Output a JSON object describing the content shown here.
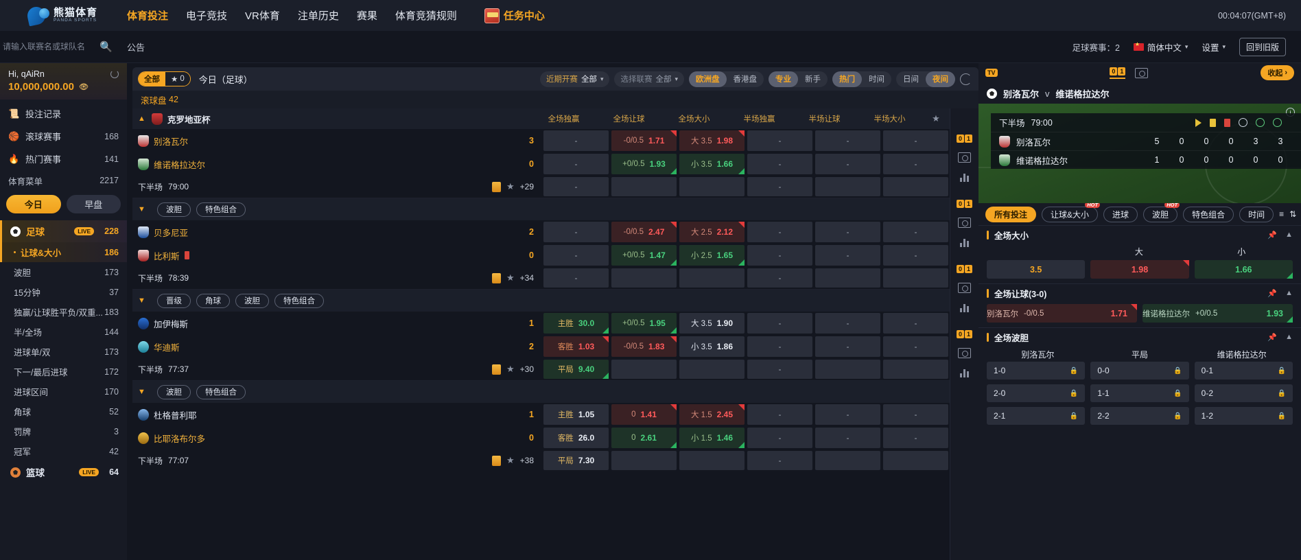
{
  "header": {
    "logo_cn": "熊猫体育",
    "logo_en": "PANDA SPORTS",
    "nav": [
      {
        "label": "体育投注",
        "active": true
      },
      {
        "label": "电子竞技",
        "active": false
      },
      {
        "label": "VR体育",
        "active": false
      },
      {
        "label": "注单历史",
        "active": false
      },
      {
        "label": "赛果",
        "active": false
      },
      {
        "label": "体育竞猜规则",
        "active": false
      }
    ],
    "mission": "任务中心",
    "clock": "00:04:07(GMT+8)"
  },
  "searchrow": {
    "placeholder": "请输入联赛名或球队名",
    "notice": "公告",
    "count": "足球赛事：2",
    "language": "简体中文",
    "settings": "设置",
    "old_version": "回到旧版"
  },
  "sidebar": {
    "greeting": "Hi, qAiRn",
    "balance": "10,000,000.00",
    "nav": [
      {
        "label": "投注记录",
        "count": "",
        "icon": "receipt-icon"
      },
      {
        "label": "滚球赛事",
        "count": "168",
        "icon": "live-ball-icon"
      },
      {
        "label": "热门赛事",
        "count": "141",
        "icon": "flame-icon"
      }
    ],
    "menu_title": "体育菜单",
    "menu_count": "2217",
    "day_tabs": [
      {
        "label": "今日",
        "active": true
      },
      {
        "label": "早盘",
        "active": false
      }
    ],
    "sport": {
      "label": "足球",
      "live": "LIVE",
      "count": "228"
    },
    "markets": [
      {
        "label": "让球&大小",
        "count": "186",
        "active": true
      },
      {
        "label": "波胆",
        "count": "173",
        "active": false
      },
      {
        "label": "15分钟",
        "count": "37",
        "active": false
      },
      {
        "label": "独赢/让球胜平负/双重...",
        "count": "183",
        "active": false
      },
      {
        "label": "半/全场",
        "count": "144",
        "active": false
      },
      {
        "label": "进球单/双",
        "count": "173",
        "active": false
      },
      {
        "label": "下一/最后进球",
        "count": "172",
        "active": false
      },
      {
        "label": "进球区间",
        "count": "170",
        "active": false
      },
      {
        "label": "角球",
        "count": "52",
        "active": false
      },
      {
        "label": "罚牌",
        "count": "3",
        "active": false
      },
      {
        "label": "冠军",
        "count": "42",
        "active": false
      }
    ],
    "sport2": {
      "label": "篮球",
      "live": "LIVE",
      "count": "64"
    }
  },
  "filterbar": {
    "seg_all": "全部",
    "seg_fav_count": "0",
    "today_label": "今日（足球）",
    "recent_key": "近期开赛",
    "recent_val": "全部",
    "league_key": "选择联赛",
    "league_val": "全部",
    "odds_types": [
      {
        "label": "欧洲盘",
        "active": true
      },
      {
        "label": "香港盘",
        "active": false
      }
    ],
    "modes": [
      {
        "label": "专业",
        "active": true
      },
      {
        "label": "新手",
        "active": false
      }
    ],
    "sorts": [
      {
        "label": "热门",
        "active": true
      },
      {
        "label": "时间",
        "active": false
      }
    ],
    "themes": [
      {
        "label": "日间",
        "active": false
      },
      {
        "label": "夜间",
        "active": true
      }
    ]
  },
  "rolling": {
    "label": "滚球盘",
    "count": "42"
  },
  "columns": [
    "全场独赢",
    "全场让球",
    "全场大小",
    "半场独赢",
    "半场让球",
    "半场大小"
  ],
  "matches": [
    {
      "league": "克罗地亚杯",
      "show_columns": true,
      "home": {
        "name": "别洛瓦尔",
        "score": "3"
      },
      "away": {
        "name": "维诺格拉达尔",
        "score": "0"
      },
      "phase": "下半场",
      "time": "79:00",
      "more": "+29",
      "home_cells": [
        {
          "type": "dash",
          "text": "-"
        },
        {
          "type": "red",
          "handicap": "-0/0.5",
          "odd": "1.71",
          "arrow": "up"
        },
        {
          "type": "red",
          "handicap": "大 3.5",
          "odd": "1.98",
          "arrow": "up"
        },
        {
          "type": "dash",
          "text": "-"
        },
        {
          "type": "dash",
          "text": "-"
        },
        {
          "type": "dash",
          "text": "-"
        }
      ],
      "away_cells": [
        {
          "type": "dash",
          "text": "-"
        },
        {
          "type": "green",
          "handicap": "+0/0.5",
          "odd": "1.93",
          "arrow": "dn"
        },
        {
          "type": "green",
          "handicap": "小 3.5",
          "odd": "1.66",
          "arrow": "dn"
        },
        {
          "type": "dash",
          "text": "-"
        },
        {
          "type": "dash",
          "text": "-"
        },
        {
          "type": "dash",
          "text": "-"
        }
      ],
      "draw_cells": [
        {
          "type": "dash",
          "text": "-"
        },
        {
          "type": "empty",
          "text": ""
        },
        {
          "type": "empty",
          "text": ""
        },
        {
          "type": "dash",
          "text": "-"
        },
        {
          "type": "empty",
          "text": ""
        },
        {
          "type": "empty",
          "text": ""
        }
      ],
      "tags": [
        "波胆",
        "特色组合"
      ]
    },
    {
      "league": "",
      "show_columns": false,
      "home": {
        "name": "贝多尼亚",
        "score": "2"
      },
      "away": {
        "name": "比利斯",
        "score": "0"
      },
      "phase": "下半场",
      "time": "78:39",
      "more": "+34",
      "home_cells": [
        {
          "type": "dash",
          "text": "-"
        },
        {
          "type": "red",
          "handicap": "-0/0.5",
          "odd": "2.47",
          "arrow": "up"
        },
        {
          "type": "red",
          "handicap": "大 2.5",
          "odd": "2.12",
          "arrow": "up"
        },
        {
          "type": "dash",
          "text": "-"
        },
        {
          "type": "dash",
          "text": "-"
        },
        {
          "type": "dash",
          "text": "-"
        }
      ],
      "away_cells": [
        {
          "type": "dash",
          "text": "-"
        },
        {
          "type": "green",
          "handicap": "+0/0.5",
          "odd": "1.47",
          "arrow": "dn"
        },
        {
          "type": "green",
          "handicap": "小 2.5",
          "odd": "1.65",
          "arrow": "dn"
        },
        {
          "type": "dash",
          "text": "-"
        },
        {
          "type": "dash",
          "text": "-"
        },
        {
          "type": "dash",
          "text": "-"
        }
      ],
      "draw_cells": [
        {
          "type": "dash",
          "text": "-"
        },
        {
          "type": "empty",
          "text": ""
        },
        {
          "type": "empty",
          "text": ""
        },
        {
          "type": "dash",
          "text": "-"
        },
        {
          "type": "empty",
          "text": ""
        },
        {
          "type": "empty",
          "text": ""
        }
      ],
      "tags": [
        "晋级",
        "角球",
        "波胆",
        "特色组合"
      ]
    },
    {
      "league": "",
      "show_columns": false,
      "home": {
        "name": "加伊梅斯",
        "score": "1"
      },
      "away": {
        "name": "华迪斯",
        "score": "2"
      },
      "phase": "下半场",
      "time": "77:37",
      "more": "+30",
      "home_cells": [
        {
          "type": "green",
          "label": "主胜",
          "odd": "30.0",
          "arrow": "dn"
        },
        {
          "type": "green",
          "handicap": "+0/0.5",
          "odd": "1.95",
          "arrow": "dn"
        },
        {
          "type": "plain",
          "handicap": "大 3.5",
          "odd": "1.90"
        },
        {
          "type": "dash",
          "text": "-"
        },
        {
          "type": "dash",
          "text": "-"
        },
        {
          "type": "dash",
          "text": "-"
        }
      ],
      "away_cells": [
        {
          "type": "red",
          "label": "客胜",
          "odd": "1.03",
          "arrow": "up"
        },
        {
          "type": "red",
          "handicap": "-0/0.5",
          "odd": "1.83",
          "arrow": "up"
        },
        {
          "type": "plain",
          "handicap": "小 3.5",
          "odd": "1.86"
        },
        {
          "type": "dash",
          "text": "-"
        },
        {
          "type": "dash",
          "text": "-"
        },
        {
          "type": "dash",
          "text": "-"
        }
      ],
      "draw_cells": [
        {
          "type": "green",
          "label": "平局",
          "odd": "9.40",
          "arrow": "dn"
        },
        {
          "type": "empty",
          "text": ""
        },
        {
          "type": "empty",
          "text": ""
        },
        {
          "type": "dash",
          "text": "-"
        },
        {
          "type": "empty",
          "text": ""
        },
        {
          "type": "empty",
          "text": ""
        }
      ],
      "tags": [
        "波胆",
        "特色组合"
      ]
    },
    {
      "league": "",
      "show_columns": false,
      "home": {
        "name": "杜格普利耶",
        "score": "1"
      },
      "away": {
        "name": "比耶洛布尔多",
        "score": "0"
      },
      "phase": "下半场",
      "time": "77:07",
      "more": "+38",
      "home_cells": [
        {
          "type": "plain",
          "label": "主胜",
          "odd": "1.05"
        },
        {
          "type": "red",
          "handicap": "0",
          "odd": "1.41",
          "arrow": "up"
        },
        {
          "type": "red",
          "handicap": "大 1.5",
          "odd": "2.45",
          "arrow": "up"
        },
        {
          "type": "dash",
          "text": "-"
        },
        {
          "type": "dash",
          "text": "-"
        },
        {
          "type": "dash",
          "text": "-"
        }
      ],
      "away_cells": [
        {
          "type": "plain",
          "label": "客胜",
          "odd": "26.0"
        },
        {
          "type": "green",
          "handicap": "0",
          "odd": "2.61",
          "arrow": "dn"
        },
        {
          "type": "green",
          "handicap": "小 1.5",
          "odd": "1.46",
          "arrow": "dn"
        },
        {
          "type": "dash",
          "text": "-"
        },
        {
          "type": "dash",
          "text": "-"
        },
        {
          "type": "dash",
          "text": "-"
        }
      ],
      "draw_cells": [
        {
          "type": "plain",
          "label": "平局",
          "odd": "7.30"
        },
        {
          "type": "empty",
          "text": ""
        },
        {
          "type": "empty",
          "text": ""
        },
        {
          "type": "dash",
          "text": "-"
        },
        {
          "type": "empty",
          "text": ""
        },
        {
          "type": "empty",
          "text": ""
        }
      ],
      "tags": []
    }
  ],
  "right_panel": {
    "tv_label": "TV",
    "collapse_label": "收起",
    "match_home": "别洛瓦尔",
    "vs": "v",
    "match_away": "维诺格拉达尔",
    "phase": "下半场",
    "time": "79:00",
    "stats_home": [
      "5",
      "0",
      "0",
      "0",
      "3",
      "3"
    ],
    "stats_away": [
      "1",
      "0",
      "0",
      "0",
      "0",
      "0"
    ],
    "tabs": [
      {
        "label": "所有投注",
        "active": true,
        "hot": false
      },
      {
        "label": "让球&大小",
        "active": false,
        "hot": true
      },
      {
        "label": "进球",
        "active": false,
        "hot": false
      },
      {
        "label": "波胆",
        "active": false,
        "hot": true
      },
      {
        "label": "特色组合",
        "active": false,
        "hot": false
      },
      {
        "label": "时间",
        "active": false,
        "hot": false
      }
    ],
    "sections": [
      {
        "title": "全场大小",
        "cols": [
          "大",
          "小"
        ],
        "row": [
          {
            "type": "plain",
            "g": "3.5"
          },
          {
            "type": "red",
            "v": "1.98",
            "arrow": "up"
          },
          {
            "type": "green",
            "v": "1.66",
            "arrow": "dn"
          }
        ]
      },
      {
        "title": "全场让球(3-0)",
        "cols": [],
        "row2": [
          {
            "type": "red",
            "nm": "别洛瓦尔",
            "k": "-0/0.5",
            "v": "1.71",
            "arrow": "up"
          },
          {
            "type": "green",
            "nm": "维诺格拉达尔",
            "k": "+0/0.5",
            "v": "1.93",
            "arrow": "dn"
          }
        ]
      },
      {
        "title": "全场波胆",
        "cols": [
          "别洛瓦尔",
          "平局",
          "维诺格拉达尔"
        ],
        "grid": [
          [
            "1-0",
            "0-0",
            "0-1"
          ],
          [
            "2-0",
            "1-1",
            "0-2"
          ],
          [
            "2-1",
            "2-2",
            "1-2"
          ]
        ]
      }
    ]
  }
}
